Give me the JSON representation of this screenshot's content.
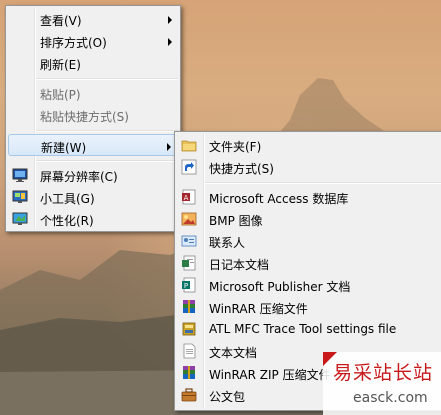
{
  "context_menu": {
    "items": [
      {
        "label": "查看(V)",
        "has_submenu": true
      },
      {
        "label": "排序方式(O)",
        "has_submenu": true
      },
      {
        "label": "刷新(E)"
      },
      {
        "label": "粘贴(P)",
        "disabled": true
      },
      {
        "label": "粘贴快捷方式(S)",
        "disabled": true
      },
      {
        "label": "新建(W)",
        "has_submenu": true,
        "highlighted": true
      },
      {
        "label": "屏幕分辨率(C)",
        "icon": "screen-resolution-icon"
      },
      {
        "label": "小工具(G)",
        "icon": "gadgets-icon"
      },
      {
        "label": "个性化(R)",
        "icon": "personalize-icon"
      }
    ]
  },
  "new_submenu": {
    "items": [
      {
        "label": "文件夹(F)",
        "icon": "folder-icon"
      },
      {
        "label": "快捷方式(S)",
        "icon": "shortcut-icon"
      },
      {
        "label": "Microsoft Access 数据库",
        "icon": "access-database-icon"
      },
      {
        "label": "BMP 图像",
        "icon": "bmp-image-icon"
      },
      {
        "label": "联系人",
        "icon": "contact-icon"
      },
      {
        "label": "日记本文档",
        "icon": "journal-document-icon"
      },
      {
        "label": "Microsoft Publisher 文档",
        "icon": "publisher-document-icon"
      },
      {
        "label": "WinRAR 压缩文件",
        "icon": "winrar-archive-icon"
      },
      {
        "label": "ATL MFC Trace Tool settings file",
        "icon": "trace-settings-icon"
      },
      {
        "label": "文本文档",
        "icon": "text-document-icon"
      },
      {
        "label": "WinRAR ZIP 压缩文件",
        "icon": "winrar-zip-icon"
      },
      {
        "label": "公文包",
        "icon": "briefcase-icon"
      }
    ]
  },
  "watermark": {
    "text_cn": "易采站长站",
    "text_en": "easck.com"
  },
  "colors": {
    "menu_bg": "#f0f0f0",
    "highlight_border": "#a8c8ea",
    "watermark_red": "#c8191b"
  }
}
